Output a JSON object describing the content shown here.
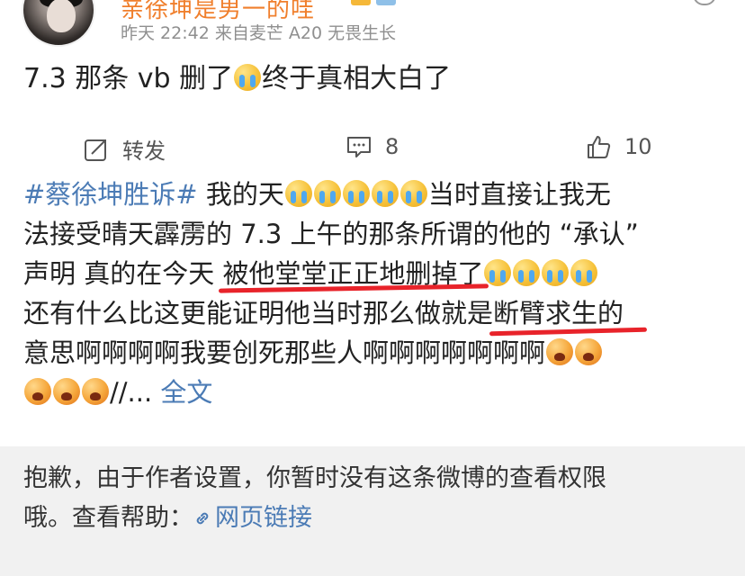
{
  "header": {
    "username_partial": "亲徐坤是男一的哇",
    "meta": "昨天 22:42  来自麦芒 A20 无畏生长"
  },
  "post": {
    "text_before": "7.3 那条 vb 删了",
    "text_after": "终于真相大白了",
    "emoji": "crying-face"
  },
  "actions": {
    "repost_label": "转发",
    "comment_count": "8",
    "like_count": "10"
  },
  "repost": {
    "hashtag": "#蔡徐坤胜诉#",
    "line1_text": " 我的天",
    "line1_tail": "当时直接让我无",
    "line2": "法接受晴天霹雳的 7.3 上午的那条所谓的他的 “承认”",
    "line3_a": "声明 真的在今天 ",
    "line3_b": "被他堂堂正正地删掉了",
    "line4_a": "还有什么比这更能证明他当时那么做就是",
    "line4_b": "断臂求生的",
    "line5": "意思啊啊啊啊我要创死那些人啊啊啊啊啊啊啊",
    "line6_tail": "//... ",
    "fulltext_label": "全文"
  },
  "notice": {
    "line1": "抱歉，由于作者设置，你暂时没有这条微博的查看权限",
    "line2_prefix": "哦。查看帮助：",
    "link_label": "网页链接"
  },
  "colors": {
    "link": "#4b7bb5",
    "highlight_stroke": "#e8232a",
    "notice_bg": "#f1f1f1"
  }
}
